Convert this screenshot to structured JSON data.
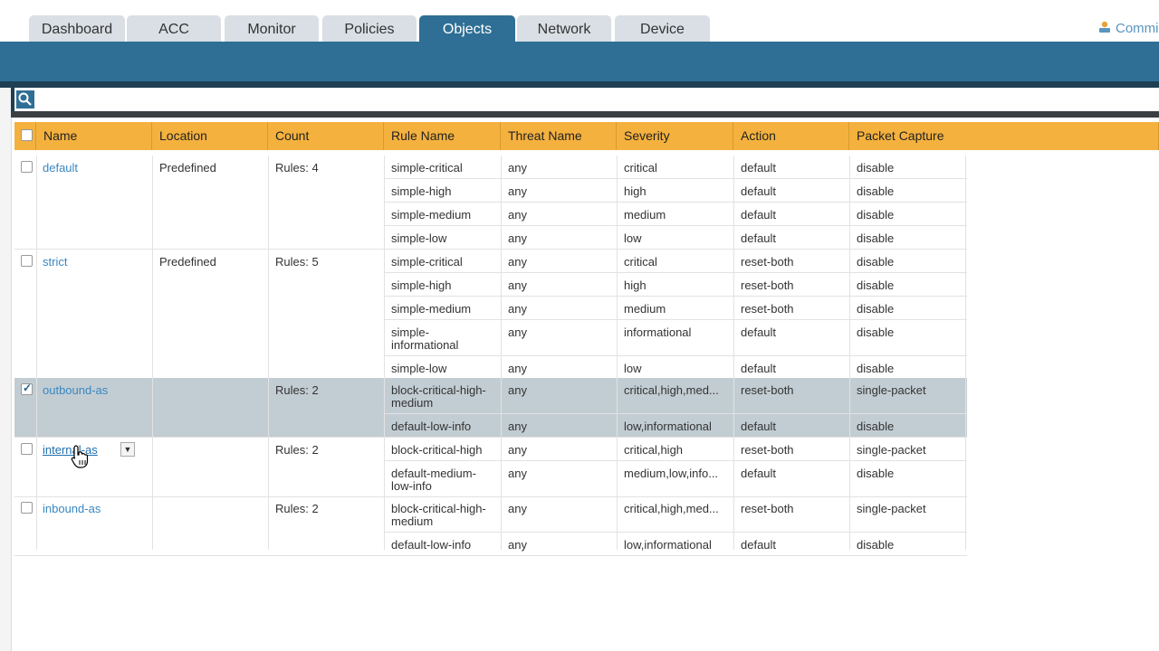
{
  "tabs": [
    {
      "label": "Dashboard",
      "active": false
    },
    {
      "label": "ACC",
      "active": false
    },
    {
      "label": "Monitor",
      "active": false
    },
    {
      "label": "Policies",
      "active": false
    },
    {
      "label": "Objects",
      "active": true
    },
    {
      "label": "Network",
      "active": false
    },
    {
      "label": "Device",
      "active": false
    }
  ],
  "commit_label": "Commi",
  "columns": [
    "Name",
    "Location",
    "Count",
    "Rule Name",
    "Threat Name",
    "Severity",
    "Action",
    "Packet Capture"
  ],
  "profiles": [
    {
      "name": "default",
      "location": "Predefined",
      "count": "Rules: 4",
      "checked": false,
      "rules": [
        {
          "rule": "simple-critical",
          "threat": "any",
          "severity": "critical",
          "action": "default",
          "capture": "disable"
        },
        {
          "rule": "simple-high",
          "threat": "any",
          "severity": "high",
          "action": "default",
          "capture": "disable"
        },
        {
          "rule": "simple-medium",
          "threat": "any",
          "severity": "medium",
          "action": "default",
          "capture": "disable"
        },
        {
          "rule": "simple-low",
          "threat": "any",
          "severity": "low",
          "action": "default",
          "capture": "disable"
        }
      ]
    },
    {
      "name": "strict",
      "location": "Predefined",
      "count": "Rules: 5",
      "checked": false,
      "rules": [
        {
          "rule": "simple-critical",
          "threat": "any",
          "severity": "critical",
          "action": "reset-both",
          "capture": "disable"
        },
        {
          "rule": "simple-high",
          "threat": "any",
          "severity": "high",
          "action": "reset-both",
          "capture": "disable"
        },
        {
          "rule": "simple-medium",
          "threat": "any",
          "severity": "medium",
          "action": "reset-both",
          "capture": "disable"
        },
        {
          "rule": "simple-\ninformational",
          "threat": "any",
          "severity": "informational",
          "action": "default",
          "capture": "disable"
        },
        {
          "rule": "simple-low",
          "threat": "any",
          "severity": "low",
          "action": "default",
          "capture": "disable"
        }
      ]
    },
    {
      "name": "outbound-as",
      "location": "",
      "count": "Rules: 2",
      "checked": true,
      "rules": [
        {
          "rule": "block-critical-high-\nmedium",
          "threat": "any",
          "severity": "critical,high,med...",
          "action": "reset-both",
          "capture": "single-packet"
        },
        {
          "rule": "default-low-info",
          "threat": "any",
          "severity": "low,informational",
          "action": "default",
          "capture": "disable"
        }
      ]
    },
    {
      "name": "internal-as",
      "location": "",
      "count": "Rules: 2",
      "checked": false,
      "rules": [
        {
          "rule": "block-critical-high",
          "threat": "any",
          "severity": "critical,high",
          "action": "reset-both",
          "capture": "single-packet"
        },
        {
          "rule": "default-medium-\nlow-info",
          "threat": "any",
          "severity": "medium,low,info...",
          "action": "default",
          "capture": "disable"
        }
      ]
    },
    {
      "name": "inbound-as",
      "location": "",
      "count": "Rules: 2",
      "checked": false,
      "rules": [
        {
          "rule": "block-critical-high-\nmedium",
          "threat": "any",
          "severity": "critical,high,med...",
          "action": "reset-both",
          "capture": "single-packet"
        },
        {
          "rule": "default-low-info",
          "threat": "any",
          "severity": "low,informational",
          "action": "default",
          "capture": "disable"
        }
      ]
    }
  ],
  "colors": {
    "header": "#f4b13e",
    "tab_active": "#2f6f95",
    "selected_row": "#c2cdd3",
    "link": "#3a87c0"
  }
}
